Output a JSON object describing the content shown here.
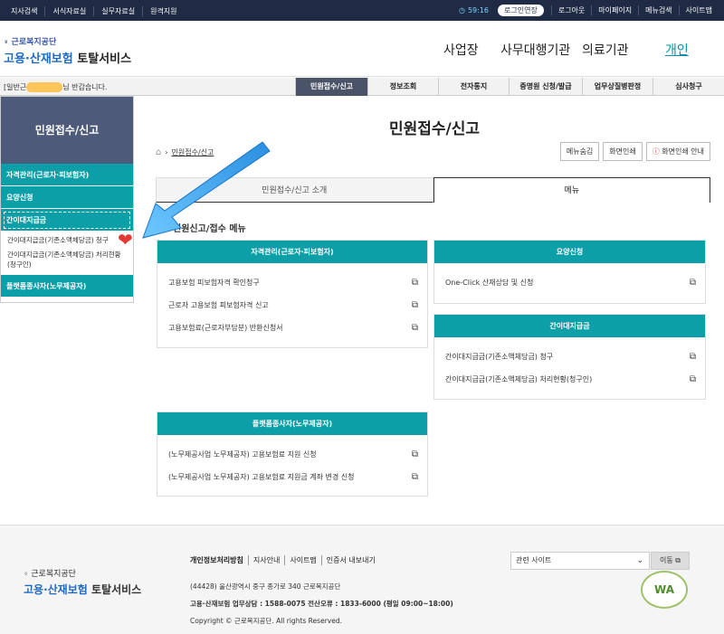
{
  "topbar": {
    "left_links": [
      "지사검색",
      "서식자료실",
      "실무자료실",
      "원격지원"
    ],
    "timer": "59:16",
    "extend_label": "로그인연장",
    "right_links": [
      "로그아웃",
      "마이페이지",
      "메뉴검색",
      "사이트맵"
    ]
  },
  "header": {
    "org": "근로복지공단",
    "svc_a": "고용·산재보험",
    "svc_b": "토탈서비스",
    "gnb": [
      "사업장",
      "사무대행기관",
      "의료기관",
      "개인"
    ]
  },
  "subbar": {
    "welcome_pre": "[일반근",
    "welcome_post": "님 반갑습니다.",
    "nav": [
      "민원접수/신고",
      "정보조회",
      "전자통지",
      "증명원 신청/발급",
      "업무상질병판정",
      "심사청구"
    ]
  },
  "lnb": {
    "title": "민원접수/신고",
    "menu1": "자격관리(근로자·피보험자)",
    "menu2": "요양신청",
    "menu3": "간이대지급금",
    "sub1": "간이대지급금(기존소액체당금) 청구",
    "sub2": "간이대지급금(기존소액체당금) 처리현황(청구인)",
    "menu4": "플랫폼종사자(노무제공자)"
  },
  "main": {
    "title": "민원접수/신고",
    "breadcrumb": "민원접수/신고",
    "btn_menu": "메뉴숨김",
    "btn_print": "화면인쇄",
    "btn_print_guide": "화면인쇄 안내",
    "tab1": "민원접수/신고 소개",
    "tab2": "메뉴",
    "section": "민원신고/접수 메뉴"
  },
  "cards": {
    "c1": {
      "title": "자격관리(근로자·피보험자)",
      "items": [
        "고용보험 피보험자격 확인청구",
        "근로자 고용보험 피보험자격 신고",
        "고용보험료(근로자부담분) 반환신청서"
      ]
    },
    "c2": {
      "title": "요양신청",
      "items": [
        "One-Click 산재상담 및 신청"
      ]
    },
    "c3": {
      "title": "간이대지급금",
      "items": [
        "간이대지급금(기존소액체당금) 청구",
        "간이대지급금(기존소액체당금) 처리현황(청구인)"
      ]
    },
    "c4": {
      "title": "플랫폼종사자(노무제공자)",
      "items": [
        "(노무제공사업 노무제공자) 고용보험료 지원 신청",
        "(노무제공사업 노무제공자) 고용보험료 지원금 계좌 변경 신청"
      ]
    }
  },
  "footer": {
    "org": "근로복지공단",
    "svc_a": "고용·산재보험",
    "svc_b": "토탈서비스",
    "links": [
      "개인정보처리방침",
      "지사안내",
      "사이트맵",
      "인증서 내보내기"
    ],
    "address": "(44428) 울산광역시 중구 종가로 340 근로복지공단",
    "phone": "고용·산재보험 업무상담 : 1588-0075  전산오류 : 1833-6000 (평일 09:00~18:00)",
    "copyright": "Copyright © 근로복지공단. All rights Reserved.",
    "related_sites": "관련 사이트",
    "go_label": "이동",
    "wa_mark": "WA"
  },
  "colors": {
    "teal": "#0d9fa8",
    "navy": "#1f2b44",
    "lnb_title": "#4d5a7a"
  }
}
